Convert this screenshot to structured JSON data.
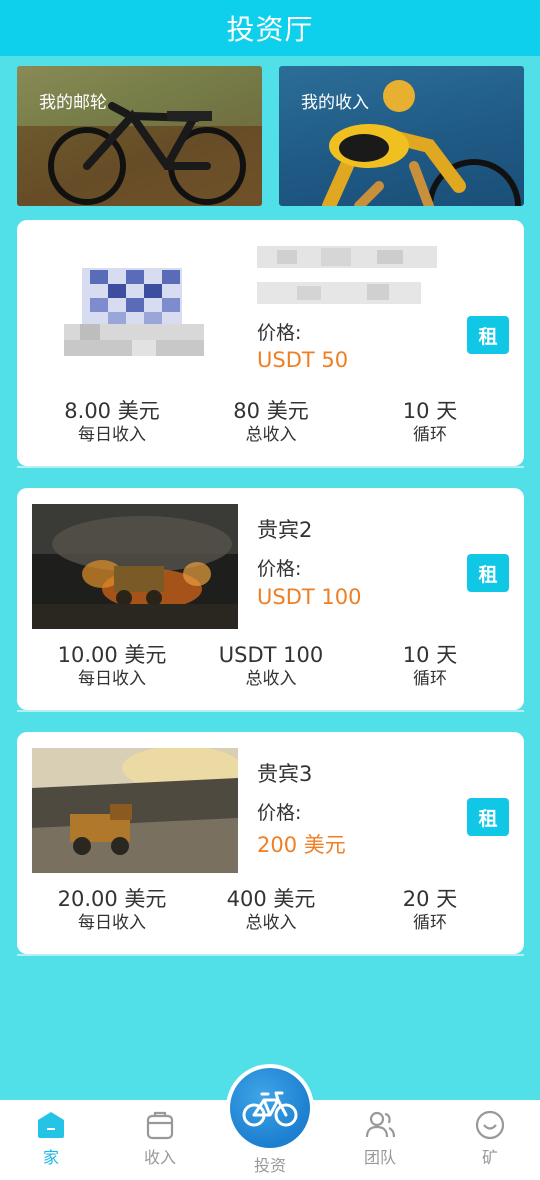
{
  "header": {
    "title": "投资厅"
  },
  "banners": [
    {
      "label": "我的邮轮"
    },
    {
      "label": "我的收入"
    }
  ],
  "products": [
    {
      "name": "",
      "price_label": "价格:",
      "price": "USDT 50",
      "rent_label": "租",
      "stats": [
        {
          "value": "8.00 美元",
          "label": "每日收入"
        },
        {
          "value": "80 美元",
          "label": "总收入"
        },
        {
          "value": "10 天",
          "label": "循环"
        }
      ]
    },
    {
      "name": "贵宾2",
      "price_label": "价格:",
      "price": "USDT 100",
      "rent_label": "租",
      "stats": [
        {
          "value": "10.00 美元",
          "label": "每日收入"
        },
        {
          "value": "USDT 100",
          "label": "总收入"
        },
        {
          "value": "10 天",
          "label": "循环"
        }
      ]
    },
    {
      "name": "贵宾3",
      "price_label": "价格:",
      "price": "200 美元",
      "rent_label": "租",
      "stats": [
        {
          "value": "20.00 美元",
          "label": "每日收入"
        },
        {
          "value": "400 美元",
          "label": "总收入"
        },
        {
          "value": "20 天",
          "label": "循环"
        }
      ]
    }
  ],
  "nav": {
    "items": [
      {
        "label": "家",
        "icon": "home-icon",
        "active": true
      },
      {
        "label": "收入",
        "icon": "bag-icon",
        "active": false
      },
      {
        "label": "投资",
        "icon": "bicycle-icon",
        "active": false
      },
      {
        "label": "团队",
        "icon": "team-icon",
        "active": false
      },
      {
        "label": "矿",
        "icon": "smile-icon",
        "active": false
      }
    ]
  },
  "colors": {
    "background": "#52e0e8",
    "header": "#0fd0ec",
    "accent": "#10c8e6",
    "price": "#f07f24",
    "nav_active": "#1ab9e3"
  }
}
